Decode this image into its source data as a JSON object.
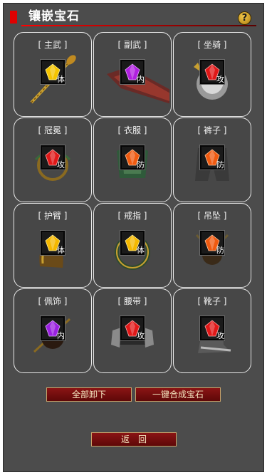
{
  "header": {
    "title": "镶嵌宝石",
    "help_label": "?"
  },
  "slots": [
    {
      "label": "[ 主武 ]",
      "stat": "体",
      "gem_color": "#f5c400"
    },
    {
      "label": "[ 副武 ]",
      "stat": "内",
      "gem_color": "#b020e0"
    },
    {
      "label": "[ 坐骑 ]",
      "stat": "攻",
      "gem_color": "#e01818"
    },
    {
      "label": "[ 冠冕 ]",
      "stat": "攻",
      "gem_color": "#e01818"
    },
    {
      "label": "[ 衣服 ]",
      "stat": "防",
      "gem_color": "#f05a10"
    },
    {
      "label": "[ 裤子 ]",
      "stat": "防",
      "gem_color": "#f05a10"
    },
    {
      "label": "[ 护臂 ]",
      "stat": "体",
      "gem_color": "#f5b800"
    },
    {
      "label": "[ 戒指 ]",
      "stat": "体",
      "gem_color": "#f5b800"
    },
    {
      "label": "[ 吊坠 ]",
      "stat": "防",
      "gem_color": "#f05a10"
    },
    {
      "label": "[ 佩饰 ]",
      "stat": "内",
      "gem_color": "#9a20e0"
    },
    {
      "label": "[ 腰带 ]",
      "stat": "攻",
      "gem_color": "#e01818"
    },
    {
      "label": "[ 靴子 ]",
      "stat": "攻",
      "gem_color": "#e01818"
    }
  ],
  "buttons": {
    "unequip_all": "全部卸下",
    "compose_gems": "一键合成宝石",
    "back": "返　回"
  }
}
